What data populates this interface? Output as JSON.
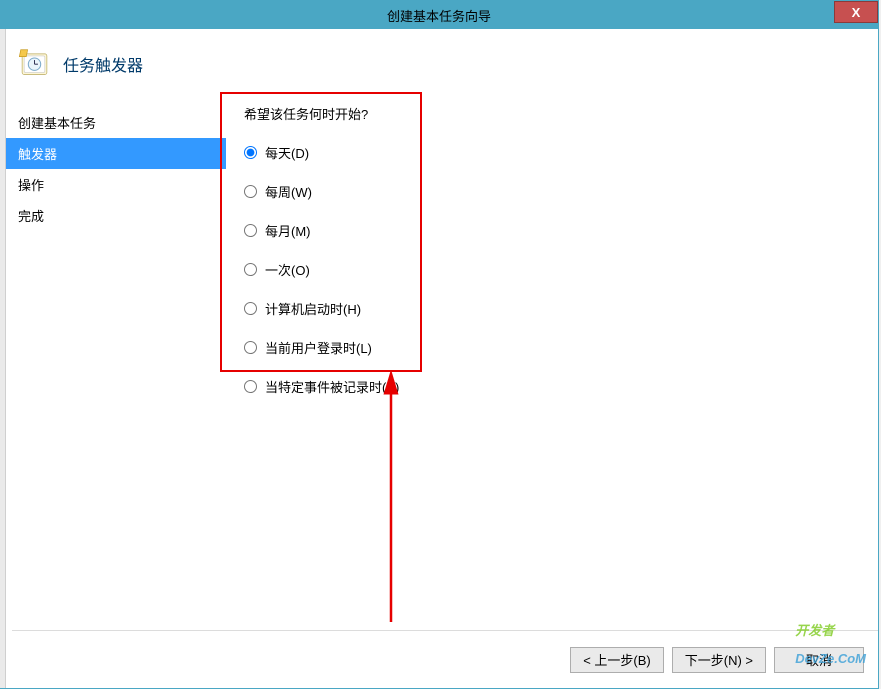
{
  "window": {
    "title": "创建基本任务向导",
    "close_label": "X"
  },
  "header": {
    "title": "任务触发器"
  },
  "sidebar": {
    "items": [
      {
        "label": "创建基本任务",
        "active": false
      },
      {
        "label": "触发器",
        "active": true
      },
      {
        "label": "操作",
        "active": false
      },
      {
        "label": "完成",
        "active": false
      }
    ]
  },
  "main": {
    "question": "希望该任务何时开始?",
    "options": [
      {
        "label": "每天(D)",
        "checked": true
      },
      {
        "label": "每周(W)",
        "checked": false
      },
      {
        "label": "每月(M)",
        "checked": false
      },
      {
        "label": "一次(O)",
        "checked": false
      },
      {
        "label": "计算机启动时(H)",
        "checked": false
      },
      {
        "label": "当前用户登录时(L)",
        "checked": false
      },
      {
        "label": "当特定事件被记录时(E)",
        "checked": false
      }
    ]
  },
  "footer": {
    "back": "< 上一步(B)",
    "next": "下一步(N) >",
    "cancel": "取消"
  },
  "watermark": {
    "prefix": "开发者",
    "text": "DevZe.CoM"
  }
}
